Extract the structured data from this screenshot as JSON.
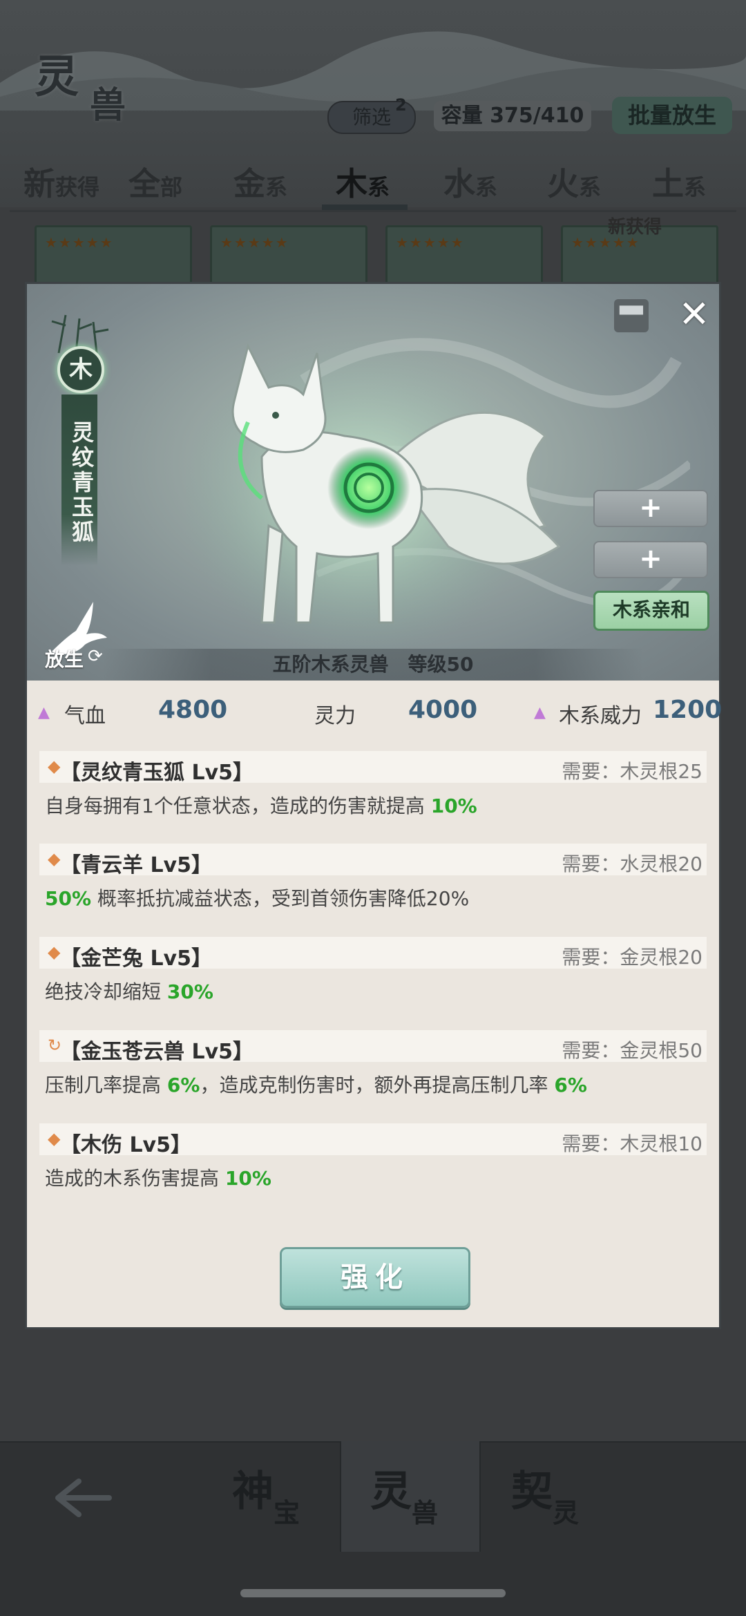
{
  "header": {
    "title_char1": "灵",
    "title_char2": "兽",
    "filter_label": "筛选",
    "filter_count": "2",
    "capacity": "容量 375/410",
    "batch_release": "批量放生"
  },
  "tabs": [
    {
      "big": "新",
      "small": "获得"
    },
    {
      "big": "全",
      "small": "部"
    },
    {
      "big": "金",
      "small": "系"
    },
    {
      "big": "木",
      "small": "系",
      "active": true
    },
    {
      "big": "水",
      "small": "系"
    },
    {
      "big": "火",
      "small": "系"
    },
    {
      "big": "土",
      "small": "系"
    }
  ],
  "thumb_new_tag": "新获得",
  "pet": {
    "element": "木",
    "name": "灵纹青玉狐",
    "release_label": "放生",
    "slot1": "+",
    "slot2": "+",
    "affinity": "木系亲和",
    "rank": "五阶木系灵兽",
    "level": "等级50"
  },
  "stats": {
    "hp_label": "气血",
    "hp_value": "4800",
    "spirit_label": "灵力",
    "spirit_value": "4000",
    "power_label": "木系威力",
    "power_value": "1200"
  },
  "skills": [
    {
      "name": "【灵纹青玉狐 Lv5】",
      "req": "需要：木灵根25",
      "d1": "自身每拥有1个任意状态，造成的伤害就提高 ",
      "g1": "10%",
      "d2": "",
      "g2": ""
    },
    {
      "name": "【青云羊 Lv5】",
      "req": "需要：水灵根20",
      "d1": "",
      "g1": "50%",
      "d2": " 概率抵抗减益状态，受到首领伤害降低20%",
      "g2": ""
    },
    {
      "name": "【金芒兔 Lv5】",
      "req": "需要：金灵根20",
      "d1": "绝技冷却缩短 ",
      "g1": "30%",
      "d2": "",
      "g2": ""
    },
    {
      "name": "【金玉苍云兽 Lv5】",
      "req": "需要：金灵根50",
      "d1": "压制几率提高 ",
      "g1": "6%",
      "d2": "，造成克制伤害时，额外再提高压制几率 ",
      "g2": "6%"
    },
    {
      "name": "【木伤 Lv5】",
      "req": "需要：木灵根10",
      "d1": "造成的木系伤害提高 ",
      "g1": "10%",
      "d2": "",
      "g2": ""
    }
  ],
  "enhance_label": "强化",
  "bottom_nav": [
    {
      "big": "神",
      "small": "宝"
    },
    {
      "big": "灵",
      "small": "兽",
      "active": true
    },
    {
      "big": "契",
      "small": "灵"
    }
  ],
  "colors": {
    "accent_green": "#2aa52a",
    "stat_blue": "#3c5f7a",
    "stat_purple": "#c07ad6"
  }
}
